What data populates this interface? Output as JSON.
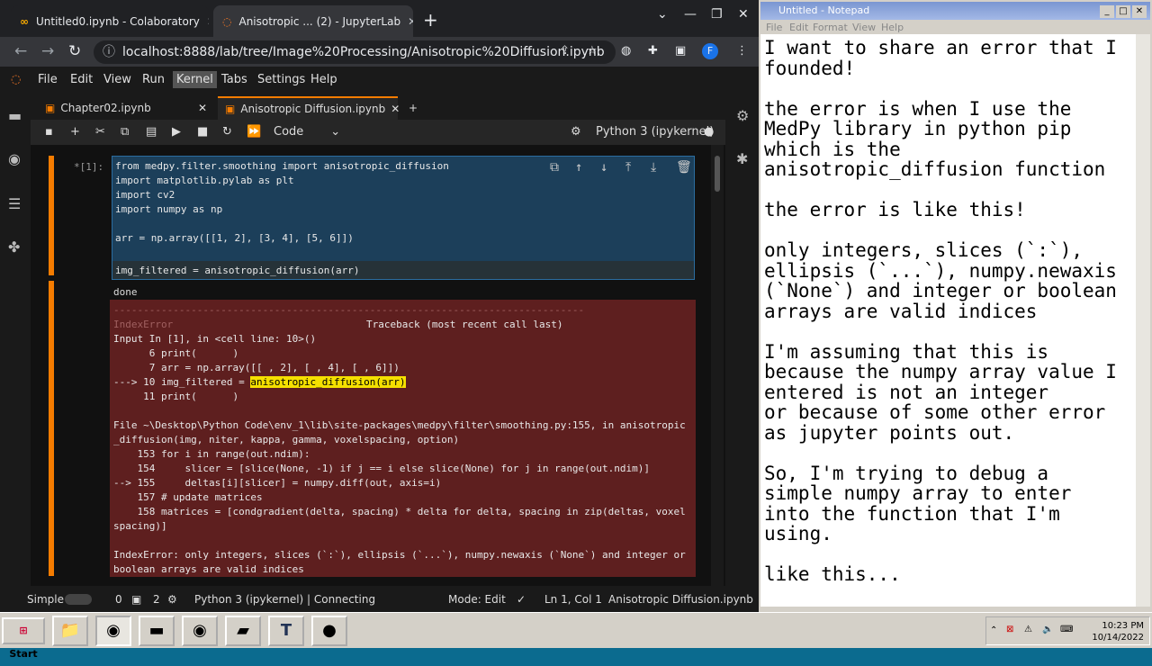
{
  "browser": {
    "tabs": [
      {
        "label": "Untitled0.ipynb - Colaboratory",
        "icon": "colab-icon"
      },
      {
        "label": "Anisotropic ... (2) - JupyterLab",
        "icon": "jupyter-icon"
      }
    ],
    "new_tab": "+",
    "url": "localhost:8888/lab/tree/Image%20Processing/Anisotropic%20Diffusion.ipynb",
    "profile": "F"
  },
  "jupyter": {
    "menu": [
      "File",
      "Edit",
      "View",
      "Run",
      "Kernel",
      "Tabs",
      "Settings",
      "Help"
    ],
    "doc_tabs": [
      "Chapter02.ipynb",
      "Anisotropic Diffusion.ipynb"
    ],
    "cell_type": "Code",
    "kernel": "Python 3 (ipykernel)",
    "prompt": "[1]:",
    "prompt_marker": "*",
    "code_lines": [
      "from medpy.filter.smoothing import anisotropic_diffusion",
      "import matplotlib.pylab as plt",
      "import cv2",
      "import numpy as np",
      "",
      "arr = np.array([[1, 2], [3, 4], [5, 6]])",
      ""
    ],
    "code_last": "img_filtered = anisotropic_diffusion(arr)",
    "output_text": "done",
    "error": {
      "divider": "-------------------------------------------------------------------------------",
      "name": "IndexError",
      "traceback_label": "Traceback (most recent call last)",
      "input_line": "Input In [1], in <cell line: 10>()",
      "lines": [
        "      6 print(      )",
        "      7 arr = np.array([[ , 2], [ , 4], [ , 6]])",
        "---> 10 img_filtered = ",
        "     11 print(      )"
      ],
      "highlight": "anisotropic_diffusion(arr)",
      "file_line": "File ~\\Desktop\\Python Code\\env_1\\lib\\site-packages\\medpy\\filter\\smoothing.py:155, in anisotropic",
      "file_line2": "_diffusion(img, niter, kappa, gamma, voxelspacing, option)",
      "src": [
        "    153 for i in range(out.ndim):",
        "    154     slicer = [slice(None, -1) if j == i else slice(None) for j in range(out.ndim)]",
        "--> 155     deltas[i][slicer] = numpy.diff(out, axis=i)",
        "    157 # update matrices",
        "    158 matrices = [condgradient(delta, spacing) * delta for delta, spacing in zip(deltas, voxel",
        "spacing)]"
      ],
      "message": "IndexError: only integers, slices (`:`), ellipsis (`...`), numpy.newaxis (`None`) and integer or",
      "message2": "boolean arrays are valid indices"
    },
    "status": {
      "mode_label": "Simple",
      "count1": "0",
      "count2": "2",
      "kernel_status": "Python 3 (ipykernel) | Connecting",
      "mode": "Mode: Edit",
      "position": "Ln 1, Col 1",
      "filename": "Anisotropic Diffusion.ipynb"
    }
  },
  "notepad": {
    "title": "Untitled - Notepad",
    "menu": [
      "File",
      "Edit",
      "Format",
      "View",
      "Help"
    ],
    "lines": [
      "I want to share an error that I",
      "founded!",
      "",
      "the error is when I use the",
      "MedPy library in python pip",
      "which is the",
      "anisotropic_diffusion function",
      "",
      "the error is like this!",
      "",
      "only integers, slices (`:`),",
      "ellipsis (`...`), numpy.newaxis",
      "(`None`) and integer or boolean",
      "arrays are valid indices",
      "",
      "I'm assuming that this is",
      "because the numpy array value I",
      "entered is not an integer",
      "or because of some other error",
      "as jupyter points out.",
      "",
      "So, I'm trying to debug a",
      "simple numpy array to enter",
      "into the function that I'm",
      "using.",
      "",
      "like this..."
    ]
  },
  "taskbar": {
    "start": "Start",
    "clock_time": "10:23 PM",
    "clock_date": "10/14/2022"
  }
}
